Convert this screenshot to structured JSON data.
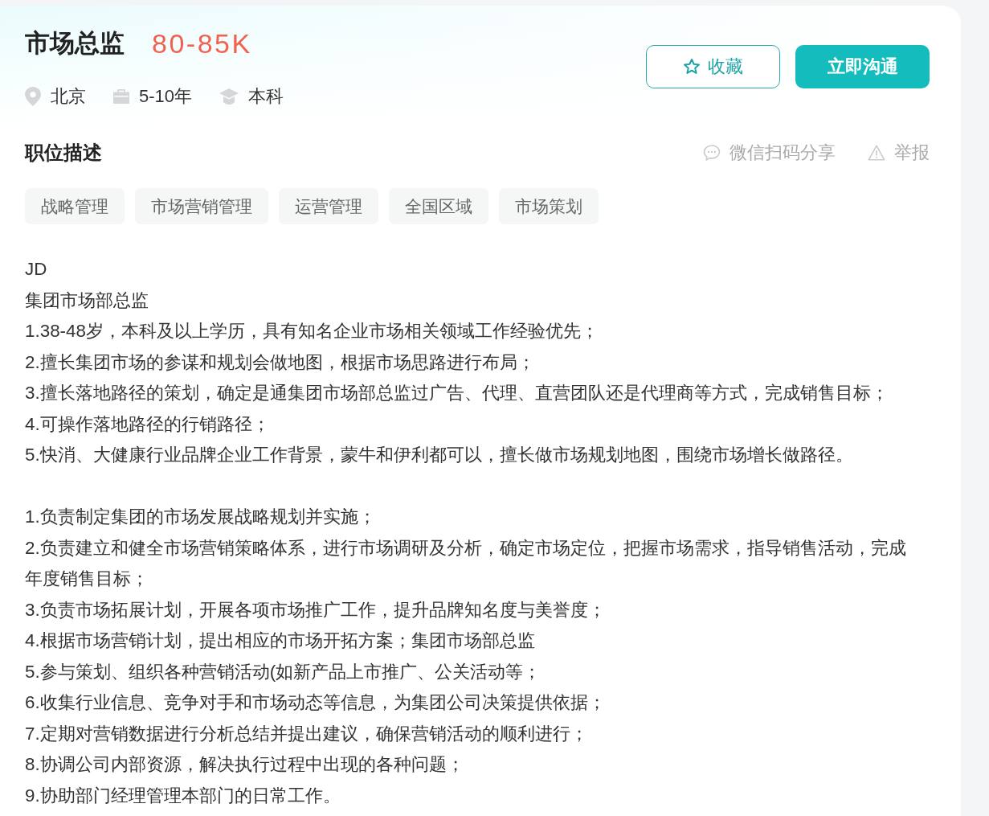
{
  "job": {
    "title": "市场总监",
    "salary": "80-85K",
    "meta": [
      {
        "kind": "location",
        "text": "北京"
      },
      {
        "kind": "experience",
        "text": "5-10年"
      },
      {
        "kind": "education",
        "text": "本科"
      }
    ]
  },
  "actions": [
    {
      "kind": "favorite",
      "label": "收藏"
    },
    {
      "kind": "contact",
      "label": "立即沟通"
    }
  ],
  "section": {
    "title": "职位描述",
    "links": [
      {
        "kind": "share",
        "label": "微信扫码分享"
      },
      {
        "kind": "report",
        "label": "举报"
      }
    ]
  },
  "tags": [
    "战略管理",
    "市场营销管理",
    "运营管理",
    "全国区域",
    "市场策划"
  ],
  "description": [
    {
      "lines": [
        "JD",
        "集团市场部总监",
        "1.38-48岁，本科及以上学历，具有知名企业市场相关领域工作经验优先；",
        "2.擅长集团市场的参谋和规划会做地图，根据市场思路进行布局；",
        "3.擅长落地路径的策划，确定是通集团市场部总监过广告、代理、直营团队还是代理商等方式，完成销售目标；",
        "4.可操作落地路径的行销路径；",
        "5.快消、大健康行业品牌企业工作背景，蒙牛和伊利都可以，擅长做市场规划地图，围绕市场增长做路径。"
      ]
    },
    {
      "lines": [
        "1.负责制定集团的市场发展战略规划并实施；",
        "2.负责建立和健全市场营销策略体系，进行市场调研及分析，确定市场定位，把握市场需求，指导销售活动，完成年度销售目标；",
        "3.负责市场拓展计划，开展各项市场推广工作，提升品牌知名度与美誉度；",
        "4.根据市场营销计划，提出相应的市场开拓方案；集团市场部总监",
        "5.参与策划、组织各种营销活动(如新产品上市推广、公关活动等；",
        "6.收集行业信息、竞争对手和市场动态等信息，为集团公司决策提供依据；",
        "7.定期对营销数据进行分析总结并提出建议，确保营销活动的顺利进行；",
        "8.协调公司内部资源，解决执行过程中出现的各种问题；",
        "9.协助部门经理管理本部门的日常工作。"
      ]
    }
  ]
}
